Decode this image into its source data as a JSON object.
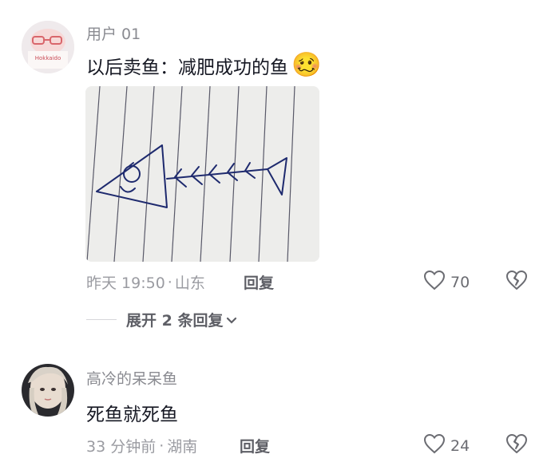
{
  "comments": [
    {
      "username": "用户 01",
      "text": "以后卖鱼：减肥成功的鱼",
      "emoji": "🥴",
      "time": "昨天 19:50",
      "location": "山东",
      "reply_label": "回复",
      "likes": "70",
      "expand_label": "展开 2 条回复",
      "avatar_text": "Hokkaido"
    },
    {
      "username": "高冷的呆呆鱼",
      "text": "死鱼就死鱼",
      "time": "33 分钟前",
      "location": "湖南",
      "reply_label": "回复",
      "likes": "24"
    }
  ],
  "colors": {
    "text": "#161823",
    "meta": "#9a9ba1",
    "username": "#8a8b91"
  }
}
